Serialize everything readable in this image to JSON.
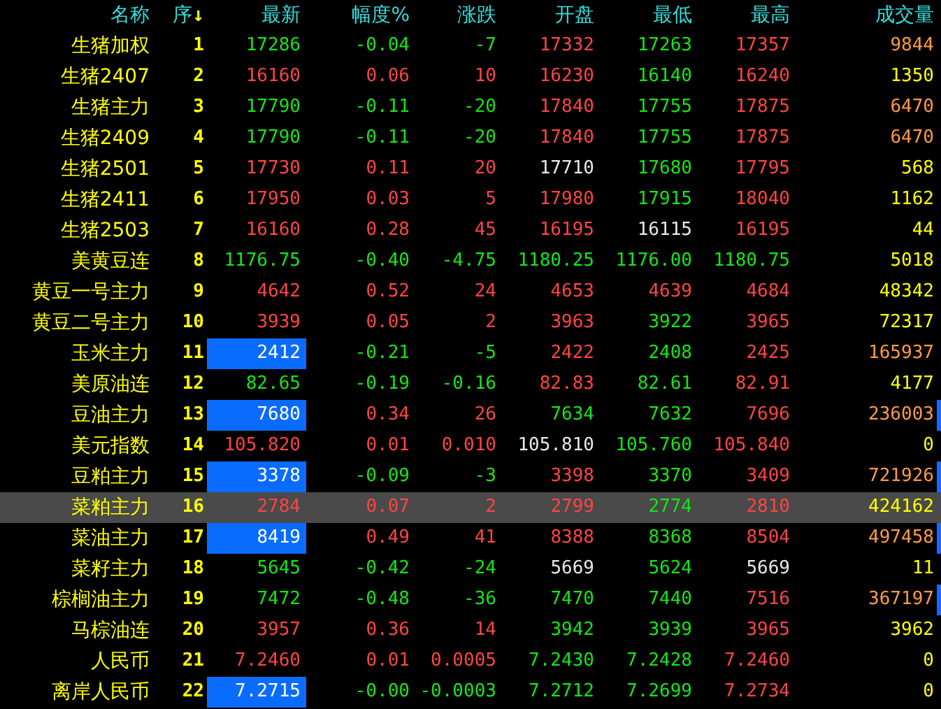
{
  "columns": [
    {
      "label": "名称"
    },
    {
      "label": "序",
      "sort_mark": "↓"
    },
    {
      "label": "最新"
    },
    {
      "label": "幅度%"
    },
    {
      "label": "涨跌"
    },
    {
      "label": "开盘"
    },
    {
      "label": "最低"
    },
    {
      "label": "最高"
    },
    {
      "label": "成交量"
    }
  ],
  "rows": [
    {
      "name": "生猪加权",
      "seq": "1",
      "cells": [
        {
          "text": "17286",
          "color": "#14e614"
        },
        {
          "text": "-0.04",
          "color": "#14e614"
        },
        {
          "text": "-7",
          "color": "#14e614"
        },
        {
          "text": "17332",
          "color": "#ff4444"
        },
        {
          "text": "17263",
          "color": "#14e614"
        },
        {
          "text": "17357",
          "color": "#ff4444"
        }
      ],
      "volume": {
        "text": "9844",
        "color": "#ff9a44"
      },
      "flag": false,
      "selected": false
    },
    {
      "name": "生猪2407",
      "seq": "2",
      "cells": [
        {
          "text": "16160",
          "color": "#ff4444"
        },
        {
          "text": "0.06",
          "color": "#ff4444"
        },
        {
          "text": "10",
          "color": "#ff4444"
        },
        {
          "text": "16230",
          "color": "#ff4444"
        },
        {
          "text": "16140",
          "color": "#14e614"
        },
        {
          "text": "16240",
          "color": "#ff4444"
        }
      ],
      "volume": {
        "text": "1350",
        "color": "#ffff00"
      },
      "flag": false,
      "selected": false
    },
    {
      "name": "生猪主力",
      "seq": "3",
      "cells": [
        {
          "text": "17790",
          "color": "#14e614"
        },
        {
          "text": "-0.11",
          "color": "#14e614"
        },
        {
          "text": "-20",
          "color": "#14e614"
        },
        {
          "text": "17840",
          "color": "#ff4444"
        },
        {
          "text": "17755",
          "color": "#14e614"
        },
        {
          "text": "17875",
          "color": "#ff4444"
        }
      ],
      "volume": {
        "text": "6470",
        "color": "#ff9a44"
      },
      "flag": false,
      "selected": false
    },
    {
      "name": "生猪2409",
      "seq": "4",
      "cells": [
        {
          "text": "17790",
          "color": "#14e614"
        },
        {
          "text": "-0.11",
          "color": "#14e614"
        },
        {
          "text": "-20",
          "color": "#14e614"
        },
        {
          "text": "17840",
          "color": "#ff4444"
        },
        {
          "text": "17755",
          "color": "#14e614"
        },
        {
          "text": "17875",
          "color": "#ff4444"
        }
      ],
      "volume": {
        "text": "6470",
        "color": "#ff9a44"
      },
      "flag": false,
      "selected": false
    },
    {
      "name": "生猪2501",
      "seq": "5",
      "cells": [
        {
          "text": "17730",
          "color": "#ff4444"
        },
        {
          "text": "0.11",
          "color": "#ff4444"
        },
        {
          "text": "20",
          "color": "#ff4444"
        },
        {
          "text": "17710",
          "color": "#e8e8e8"
        },
        {
          "text": "17680",
          "color": "#14e614"
        },
        {
          "text": "17795",
          "color": "#ff4444"
        }
      ],
      "volume": {
        "text": "568",
        "color": "#ffff00"
      },
      "flag": false,
      "selected": false
    },
    {
      "name": "生猪2411",
      "seq": "6",
      "cells": [
        {
          "text": "17950",
          "color": "#ff4444"
        },
        {
          "text": "0.03",
          "color": "#ff4444"
        },
        {
          "text": "5",
          "color": "#ff4444"
        },
        {
          "text": "17980",
          "color": "#ff4444"
        },
        {
          "text": "17915",
          "color": "#14e614"
        },
        {
          "text": "18040",
          "color": "#ff4444"
        }
      ],
      "volume": {
        "text": "1162",
        "color": "#ffff00"
      },
      "flag": false,
      "selected": false
    },
    {
      "name": "生猪2503",
      "seq": "7",
      "cells": [
        {
          "text": "16160",
          "color": "#ff4444"
        },
        {
          "text": "0.28",
          "color": "#ff4444"
        },
        {
          "text": "45",
          "color": "#ff4444"
        },
        {
          "text": "16195",
          "color": "#ff4444"
        },
        {
          "text": "16115",
          "color": "#e8e8e8"
        },
        {
          "text": "16195",
          "color": "#ff4444"
        }
      ],
      "volume": {
        "text": "44",
        "color": "#ffff00"
      },
      "flag": false,
      "selected": false
    },
    {
      "name": "美黄豆连",
      "seq": "8",
      "cells": [
        {
          "text": "1176.75",
          "color": "#14e614"
        },
        {
          "text": "-0.40",
          "color": "#14e614"
        },
        {
          "text": "-4.75",
          "color": "#14e614"
        },
        {
          "text": "1180.25",
          "color": "#14e614"
        },
        {
          "text": "1176.00",
          "color": "#14e614"
        },
        {
          "text": "1180.75",
          "color": "#14e614"
        }
      ],
      "volume": {
        "text": "5018",
        "color": "#ffff00"
      },
      "flag": false,
      "selected": false
    },
    {
      "name": "黄豆一号主力",
      "seq": "9",
      "cells": [
        {
          "text": "4642",
          "color": "#ff4444"
        },
        {
          "text": "0.52",
          "color": "#ff4444"
        },
        {
          "text": "24",
          "color": "#ff4444"
        },
        {
          "text": "4653",
          "color": "#ff4444"
        },
        {
          "text": "4639",
          "color": "#ff4444"
        },
        {
          "text": "4684",
          "color": "#ff4444"
        }
      ],
      "volume": {
        "text": "48342",
        "color": "#ffff00"
      },
      "flag": false,
      "selected": false
    },
    {
      "name": "黄豆二号主力",
      "seq": "10",
      "cells": [
        {
          "text": "3939",
          "color": "#ff4444"
        },
        {
          "text": "0.05",
          "color": "#ff4444"
        },
        {
          "text": "2",
          "color": "#ff4444"
        },
        {
          "text": "3963",
          "color": "#ff4444"
        },
        {
          "text": "3922",
          "color": "#14e614"
        },
        {
          "text": "3965",
          "color": "#ff4444"
        }
      ],
      "volume": {
        "text": "72317",
        "color": "#ffff00"
      },
      "flag": false,
      "selected": false
    },
    {
      "name": "玉米主力",
      "seq": "11",
      "cells": [
        {
          "text": "2412",
          "highlighted": true
        },
        {
          "text": "-0.21",
          "color": "#14e614"
        },
        {
          "text": "-5",
          "color": "#14e614"
        },
        {
          "text": "2422",
          "color": "#ff4444"
        },
        {
          "text": "2408",
          "color": "#14e614"
        },
        {
          "text": "2425",
          "color": "#ff4444"
        }
      ],
      "volume": {
        "text": "165937",
        "color": "#ff9a44"
      },
      "flag": false,
      "selected": false
    },
    {
      "name": "美原油连",
      "seq": "12",
      "cells": [
        {
          "text": "82.65",
          "color": "#14e614"
        },
        {
          "text": "-0.19",
          "color": "#14e614"
        },
        {
          "text": "-0.16",
          "color": "#14e614"
        },
        {
          "text": "82.83",
          "color": "#ff4444"
        },
        {
          "text": "82.61",
          "color": "#14e614"
        },
        {
          "text": "82.91",
          "color": "#ff4444"
        }
      ],
      "volume": {
        "text": "4177",
        "color": "#ffff00"
      },
      "flag": false,
      "selected": false
    },
    {
      "name": "豆油主力",
      "seq": "13",
      "cells": [
        {
          "text": "7680",
          "highlighted": true
        },
        {
          "text": "0.34",
          "color": "#ff4444"
        },
        {
          "text": "26",
          "color": "#ff4444"
        },
        {
          "text": "7634",
          "color": "#14e614"
        },
        {
          "text": "7632",
          "color": "#14e614"
        },
        {
          "text": "7696",
          "color": "#ff4444"
        }
      ],
      "volume": {
        "text": "236003",
        "color": "#ff9a44"
      },
      "flag": true,
      "selected": false
    },
    {
      "name": "美元指数",
      "seq": "14",
      "cells": [
        {
          "text": "105.820",
          "color": "#ff4444"
        },
        {
          "text": "0.01",
          "color": "#ff4444"
        },
        {
          "text": "0.010",
          "color": "#ff4444"
        },
        {
          "text": "105.810",
          "color": "#e8e8e8"
        },
        {
          "text": "105.760",
          "color": "#14e614"
        },
        {
          "text": "105.840",
          "color": "#ff4444"
        }
      ],
      "volume": {
        "text": "0",
        "color": "#ffff00"
      },
      "flag": false,
      "selected": false
    },
    {
      "name": "豆粕主力",
      "seq": "15",
      "cells": [
        {
          "text": "3378",
          "highlighted": true
        },
        {
          "text": "-0.09",
          "color": "#14e614"
        },
        {
          "text": "-3",
          "color": "#14e614"
        },
        {
          "text": "3398",
          "color": "#ff4444"
        },
        {
          "text": "3370",
          "color": "#14e614"
        },
        {
          "text": "3409",
          "color": "#ff4444"
        }
      ],
      "volume": {
        "text": "721926",
        "color": "#ff9a44"
      },
      "flag": true,
      "selected": false
    },
    {
      "name": "菜粕主力",
      "seq": "16",
      "cells": [
        {
          "text": "2784",
          "color": "#ff4444"
        },
        {
          "text": "0.07",
          "color": "#ff4444"
        },
        {
          "text": "2",
          "color": "#ff4444"
        },
        {
          "text": "2799",
          "color": "#ff4444"
        },
        {
          "text": "2774",
          "color": "#14e614"
        },
        {
          "text": "2810",
          "color": "#ff4444"
        }
      ],
      "volume": {
        "text": "424162",
        "color": "#ffff00"
      },
      "flag": false,
      "selected": true
    },
    {
      "name": "菜油主力",
      "seq": "17",
      "cells": [
        {
          "text": "8419",
          "highlighted": true
        },
        {
          "text": "0.49",
          "color": "#ff4444"
        },
        {
          "text": "41",
          "color": "#ff4444"
        },
        {
          "text": "8388",
          "color": "#ff4444"
        },
        {
          "text": "8368",
          "color": "#14e614"
        },
        {
          "text": "8504",
          "color": "#ff4444"
        }
      ],
      "volume": {
        "text": "497458",
        "color": "#ff9a44"
      },
      "flag": true,
      "selected": false
    },
    {
      "name": "菜籽主力",
      "seq": "18",
      "cells": [
        {
          "text": "5645",
          "color": "#14e614"
        },
        {
          "text": "-0.42",
          "color": "#14e614"
        },
        {
          "text": "-24",
          "color": "#14e614"
        },
        {
          "text": "5669",
          "color": "#e8e8e8"
        },
        {
          "text": "5624",
          "color": "#14e614"
        },
        {
          "text": "5669",
          "color": "#e8e8e8"
        }
      ],
      "volume": {
        "text": "11",
        "color": "#ffff00"
      },
      "flag": false,
      "selected": false
    },
    {
      "name": "棕榈油主力",
      "seq": "19",
      "cells": [
        {
          "text": "7472",
          "color": "#14e614"
        },
        {
          "text": "-0.48",
          "color": "#14e614"
        },
        {
          "text": "-36",
          "color": "#14e614"
        },
        {
          "text": "7470",
          "color": "#14e614"
        },
        {
          "text": "7440",
          "color": "#14e614"
        },
        {
          "text": "7516",
          "color": "#ff4444"
        }
      ],
      "volume": {
        "text": "367197",
        "color": "#ff9a44"
      },
      "flag": true,
      "selected": false
    },
    {
      "name": "马棕油连",
      "seq": "20",
      "cells": [
        {
          "text": "3957",
          "color": "#ff4444"
        },
        {
          "text": "0.36",
          "color": "#ff4444"
        },
        {
          "text": "14",
          "color": "#ff4444"
        },
        {
          "text": "3942",
          "color": "#14e614"
        },
        {
          "text": "3939",
          "color": "#14e614"
        },
        {
          "text": "3965",
          "color": "#ff4444"
        }
      ],
      "volume": {
        "text": "3962",
        "color": "#ffff00"
      },
      "flag": false,
      "selected": false
    },
    {
      "name": "人民币",
      "seq": "21",
      "cells": [
        {
          "text": "7.2460",
          "color": "#ff4444"
        },
        {
          "text": "0.01",
          "color": "#ff4444"
        },
        {
          "text": "0.0005",
          "color": "#ff4444"
        },
        {
          "text": "7.2430",
          "color": "#14e614"
        },
        {
          "text": "7.2428",
          "color": "#14e614"
        },
        {
          "text": "7.2460",
          "color": "#ff4444"
        }
      ],
      "volume": {
        "text": "0",
        "color": "#ffff00"
      },
      "flag": false,
      "selected": false
    },
    {
      "name": "离岸人民币",
      "seq": "22",
      "cells": [
        {
          "text": "7.2715",
          "highlighted": true
        },
        {
          "text": "-0.00",
          "color": "#14e614"
        },
        {
          "text": "-0.0003",
          "color": "#14e614"
        },
        {
          "text": "7.2712",
          "color": "#14e614"
        },
        {
          "text": "7.2699",
          "color": "#14e614"
        },
        {
          "text": "7.2734",
          "color": "#ff4444"
        }
      ],
      "volume": {
        "text": "0",
        "color": "#ffff00"
      },
      "flag": false,
      "selected": false
    }
  ]
}
